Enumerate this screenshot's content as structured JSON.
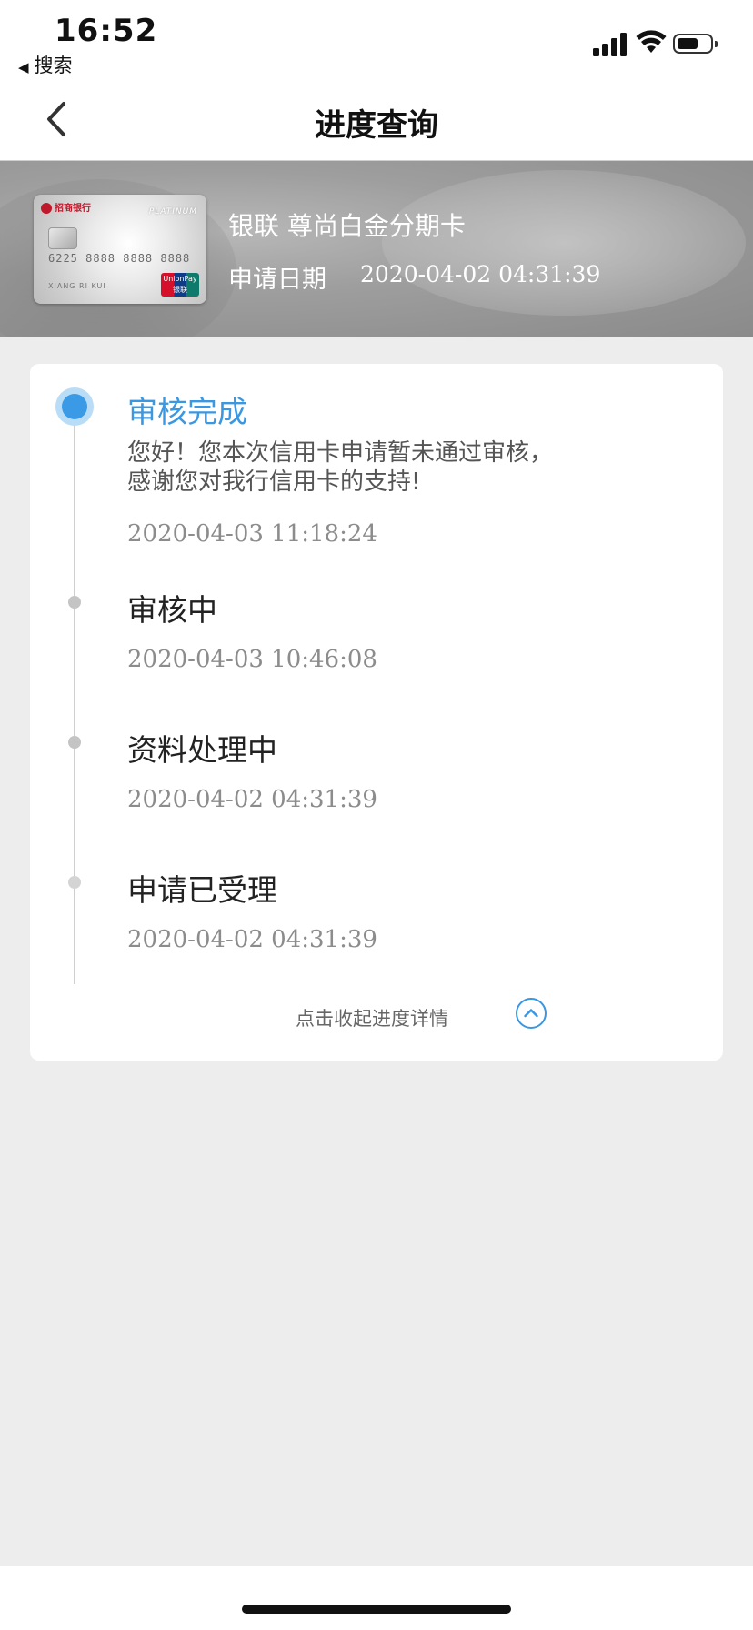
{
  "status_bar": {
    "time": "16:52",
    "back_app": "搜索",
    "icons": [
      "cellular-signal-icon",
      "wifi-icon",
      "battery-icon"
    ]
  },
  "nav": {
    "title": "进度查询",
    "back_icon": "chevron-left-icon"
  },
  "card": {
    "name": "银联 尊尚白金分期卡",
    "date_label": "申请日期",
    "date_value": "2020-04-02 04:31:39",
    "image": {
      "bank": "招商银行",
      "tier": "PLATINUM",
      "number": "6225 8888 8888 8888",
      "holder": "XIANG RI KUI",
      "network": "UnionPay 银联"
    }
  },
  "progress": {
    "steps": [
      {
        "title": "审核完成",
        "description": "您好！您本次信用卡申请暂未通过审核，感谢您对我行信用卡的支持!",
        "time": "2020-04-03 11:18:24",
        "active": true
      },
      {
        "title": "审核中",
        "time": "2020-04-03 10:46:08",
        "active": false
      },
      {
        "title": "资料处理中",
        "time": "2020-04-02 04:31:39",
        "active": false
      },
      {
        "title": "申请已受理",
        "time": "2020-04-02 04:31:39",
        "active": false
      }
    ],
    "collapse_label": "点击收起进度详情",
    "collapse_icon": "chevron-up-circle-icon"
  },
  "colors": {
    "accent": "#3a97e2",
    "background": "#ededed",
    "timeline": "#cfcfcf"
  }
}
